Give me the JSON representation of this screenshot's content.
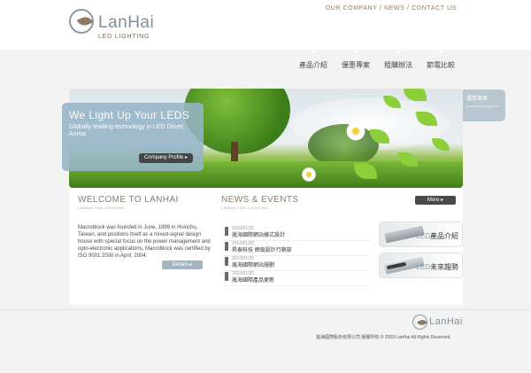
{
  "brand": {
    "name": "LanHai",
    "tagline": "LED LIGHTING"
  },
  "top_nav": {
    "company": "OUR COMPANY",
    "news": "NEWS",
    "contact": "CONTACT US",
    "separator": " / "
  },
  "main_nav": [
    "產品介紹",
    "優惠專案",
    "租購辦法",
    "節電比較"
  ],
  "hero": {
    "title": "We Light Up Your LEDS",
    "subtitle": "Globally leading technology in LED Driver, AnHai",
    "button": "Company Profile",
    "side_tab_label": "優惠專案",
    "side_tab_sub": "promotion programs"
  },
  "welcome": {
    "title": "WELCOME TO LANHAI",
    "subtitle": "LANHAI LED LIGHTING",
    "body": "Macroblock was founded in June, 1999 in Hsinchu, Taiwan, and positions itself as a mixed-signal design house with special focus on the power management and opto-electronic applications, Macroblock was certified by ISO 9001:2000 in April, 2004.",
    "details_button": "Details"
  },
  "news": {
    "title": "NEWS & EVENTS",
    "subtitle": "LANHAI LED LIGHTING",
    "more_button": "More",
    "items": [
      {
        "date": "2010/01/20",
        "title": "嵐海國際網站樣式設計"
      },
      {
        "date": "2010/01/20",
        "title": "昇泰科技 網頁設計行銷部"
      },
      {
        "date": "2010/01/20",
        "title": "嵐海國際網站規劃"
      },
      {
        "date": "2010/01/20",
        "title": "嵐海國際產品更新"
      }
    ]
  },
  "side_banners": [
    {
      "led": "LED",
      "label": "產品介紹"
    },
    {
      "led": "LED",
      "label": "未來趨勢"
    }
  ],
  "footer": {
    "logo_name": "LanHai",
    "copyright": "嵐海國際股份有限公司 版權所有 © 2009 LanHai All Rights Reserved."
  },
  "colors": {
    "brand_gray_blue": "#7d8f9a",
    "brand_brown": "#8c7b62",
    "promo_panel": "#96b4c6",
    "dark_button": "#454545"
  },
  "icons": {
    "logo": "leaf-circle-icon",
    "news_bullet": "square-bullet-icon",
    "arrow": "play-arrow-icon"
  }
}
